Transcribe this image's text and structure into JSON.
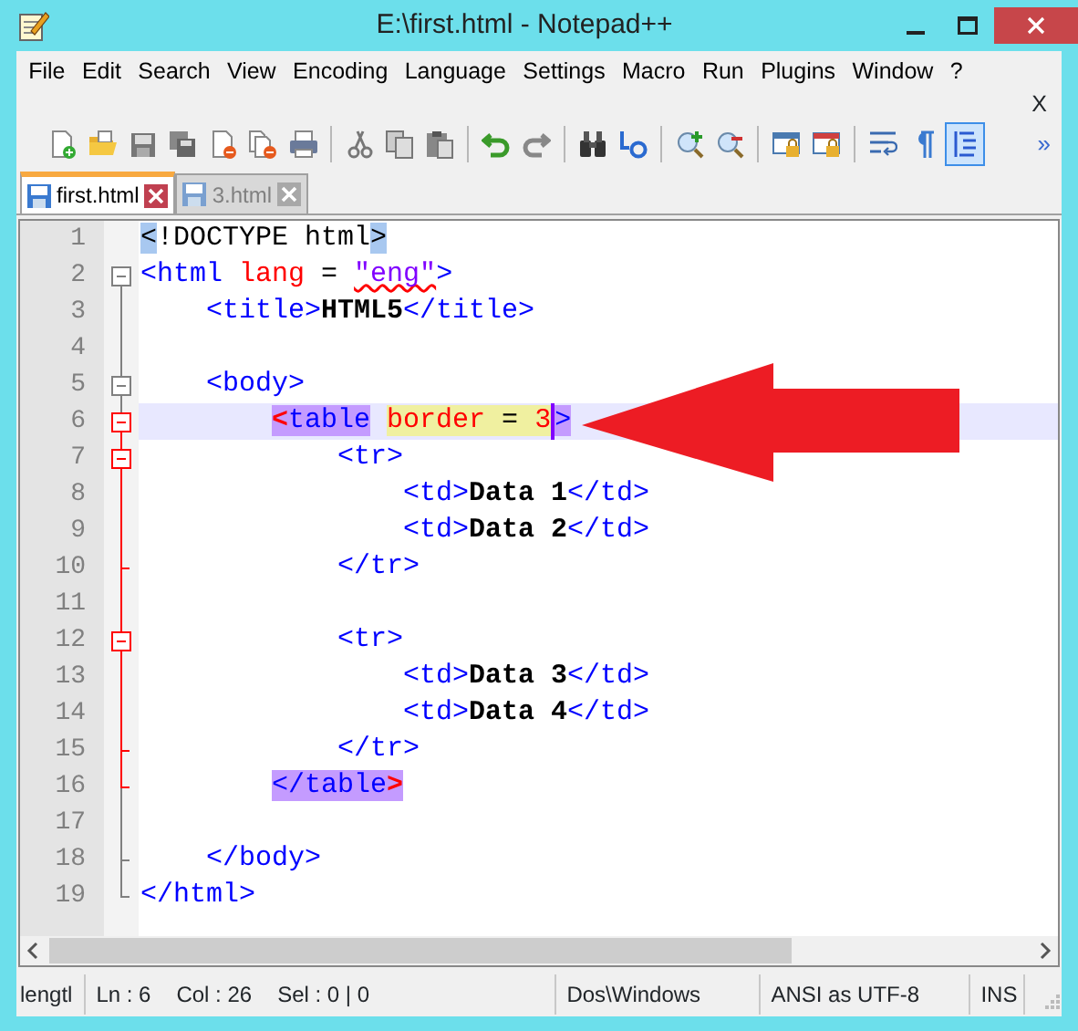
{
  "window": {
    "title": "E:\\first.html - Notepad++"
  },
  "menu": [
    "File",
    "Edit",
    "Search",
    "View",
    "Encoding",
    "Language",
    "Settings",
    "Macro",
    "Run",
    "Plugins",
    "Window",
    "?"
  ],
  "menu_close": "X",
  "toolbar": {
    "groups": [
      [
        {
          "pressed": false
        },
        {
          "pressed": false
        },
        {
          "pressed": false
        },
        {
          "pressed": false
        },
        {
          "pressed": false
        },
        {
          "pressed": false
        },
        {
          "pressed": false
        }
      ],
      [
        {
          "pressed": false
        },
        {
          "pressed": false
        },
        {
          "pressed": false
        }
      ],
      [
        {
          "pressed": false
        },
        {
          "pressed": false
        }
      ],
      [
        {
          "pressed": false
        },
        {
          "pressed": false
        }
      ],
      [
        {
          "pressed": false
        },
        {
          "pressed": false
        }
      ],
      [
        {
          "pressed": false
        },
        {
          "pressed": false
        }
      ],
      [
        {
          "pressed": false
        },
        {
          "pressed": false
        },
        {
          "pressed": true
        }
      ]
    ],
    "overflow": "»"
  },
  "tabs": [
    {
      "label": "first.html",
      "selected": true
    },
    {
      "label": "3.html",
      "selected": false
    }
  ],
  "editor": {
    "lines": [
      {
        "number": "1",
        "tokens": [
          {
            "kind": "doctype",
            "text": "<",
            "brace_match": true
          },
          {
            "kind": "doctype",
            "text": "!DOCTYPE html"
          },
          {
            "kind": "doctype",
            "text": ">",
            "brace_match": true
          }
        ]
      },
      {
        "number": "2",
        "tokens": [
          {
            "kind": "tag",
            "text": "<html"
          },
          {
            "kind": "attr",
            "text": " lang"
          },
          {
            "kind": "op",
            "text": " = "
          },
          {
            "kind": "value",
            "text": "\"eng\"",
            "misspelled": true
          },
          {
            "kind": "tag",
            "text": ">"
          }
        ],
        "children": [
          {
            "number": "3",
            "tokens": [
              {
                "kind": "tag",
                "text": "<title>"
              },
              {
                "kind": "text",
                "text": "HTML5"
              },
              {
                "kind": "tag",
                "text": "</title>"
              }
            ]
          },
          {
            "number": "4"
          },
          {
            "number": "5",
            "tokens": [
              {
                "kind": "tag",
                "text": "<body>"
              }
            ],
            "children": [
              {
                "number": "6",
                "tokens": [
                  {
                    "kind": "bracket-hit",
                    "text": "<",
                    "tag_match": true
                  },
                  {
                    "kind": "tag",
                    "text": "table",
                    "tag_match": true
                  },
                  {
                    "kind": "attr",
                    "text": "border",
                    "smart_highlight": true,
                    "spaced": true
                  },
                  {
                    "kind": "op",
                    "text": " = ",
                    "smart_highlight": true
                  },
                  {
                    "kind": "attr",
                    "text": "3",
                    "smart_highlight": true
                  },
                  {
                    "kind": "tag",
                    "text": ">",
                    "tag_match": true,
                    "caret": true
                  }
                ],
                "children": [
                  {
                    "number": "7",
                    "tokens": [
                      {
                        "kind": "tag",
                        "text": "<tr>"
                      }
                    ],
                    "children": [
                      {
                        "number": "8",
                        "tokens": [
                          {
                            "kind": "tag",
                            "text": "<td>"
                          },
                          {
                            "kind": "text",
                            "text": "Data 1"
                          },
                          {
                            "kind": "tag",
                            "text": "</td>"
                          }
                        ]
                      },
                      {
                        "number": "9",
                        "tokens": [
                          {
                            "kind": "tag",
                            "text": "<td>"
                          },
                          {
                            "kind": "text",
                            "text": "Data 2"
                          },
                          {
                            "kind": "tag",
                            "text": "</td>"
                          }
                        ]
                      }
                    ],
                    "end": {
                      "number": "10",
                      "tokens": [
                        {
                          "kind": "tag",
                          "text": "</tr>"
                        }
                      ]
                    }
                  },
                  {
                    "number": "11"
                  },
                  {
                    "number": "12",
                    "tokens": [
                      {
                        "kind": "tag",
                        "text": "<tr>"
                      }
                    ],
                    "children": [
                      {
                        "number": "13",
                        "tokens": [
                          {
                            "kind": "tag",
                            "text": "<td>"
                          },
                          {
                            "kind": "text",
                            "text": "Data 3"
                          },
                          {
                            "kind": "tag",
                            "text": "</td>"
                          }
                        ]
                      },
                      {
                        "number": "14",
                        "tokens": [
                          {
                            "kind": "tag",
                            "text": "<td>"
                          },
                          {
                            "kind": "text",
                            "text": "Data 4"
                          },
                          {
                            "kind": "tag",
                            "text": "</td>"
                          }
                        ]
                      }
                    ],
                    "end": {
                      "number": "15",
                      "tokens": [
                        {
                          "kind": "tag",
                          "text": "</tr>"
                        }
                      ]
                    }
                  }
                ],
                "end": {
                  "number": "16",
                  "tokens": [
                    {
                      "kind": "tag",
                      "text": "</table",
                      "tag_match": true
                    },
                    {
                      "kind": "bracket-hit",
                      "text": ">",
                      "tag_match": true
                    }
                  ]
                }
              },
              {
                "number": "17"
              }
            ],
            "end": {
              "number": "18",
              "tokens": [
                {
                  "kind": "tag",
                  "text": "</body>"
                }
              ]
            }
          }
        ],
        "end": {
          "number": "19",
          "tokens": [
            {
              "kind": "tag",
              "text": "</html>"
            }
          ]
        }
      }
    ]
  },
  "status_bar": [
    {
      "texts": [
        "lengtl"
      ]
    },
    {
      "texts": [
        "Ln : 6",
        "Col : 26",
        "Sel : 0 | 0"
      ]
    },
    {
      "texts": [
        "Dos\\Windows"
      ]
    },
    {
      "texts": [
        "ANSI as UTF-8"
      ]
    },
    {
      "texts": [
        "INS"
      ]
    }
  ]
}
